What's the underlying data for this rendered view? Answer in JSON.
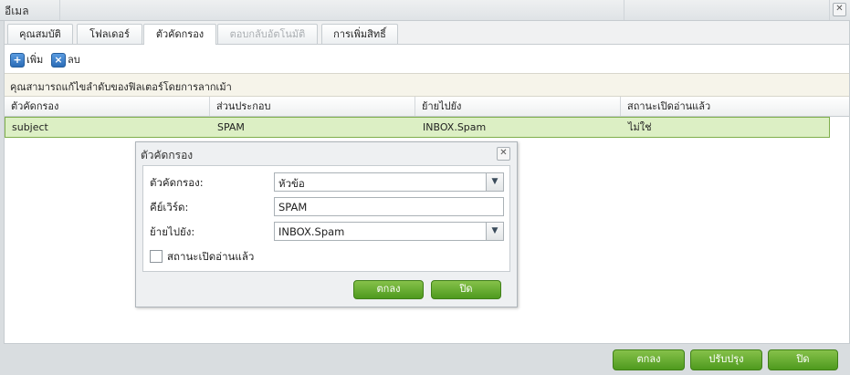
{
  "window": {
    "title": "อีเมล"
  },
  "tabs": [
    {
      "label": "คุณสมบัติ"
    },
    {
      "label": "โฟลเดอร์"
    },
    {
      "label": "ตัวคัดกรอง"
    },
    {
      "label": "ตอบกลับอัตโนมัติ"
    },
    {
      "label": "การเพิ่มสิทธิ์"
    }
  ],
  "toolbar": {
    "add_label": "เพิ่ม",
    "delete_label": "ลบ"
  },
  "info": {
    "text": "คุณสามารถแก้ไขลำดับของฟิลเตอร์โดยการลากเม้า"
  },
  "grid": {
    "headers": [
      "ตัวคัดกรอง",
      "ส่วนประกอบ",
      "ย้ายไปยัง",
      "สถานะเปิดอ่านแล้ว"
    ],
    "rows": [
      {
        "filter": "subject",
        "component": "SPAM",
        "move_to": "INBOX.Spam",
        "read_status": "ไม่ใช่"
      }
    ]
  },
  "dialog": {
    "title": "ตัวคัดกรอง",
    "filter_label": "ตัวคัดกรอง:",
    "filter_value": "หัวข้อ",
    "keyword_label": "คีย์เวิร์ด:",
    "keyword_value": "SPAM",
    "moveto_label": "ย้ายไปยัง:",
    "moveto_value": "INBOX.Spam",
    "mark_read_label": "สถานะเปิดอ่านแล้ว",
    "ok_label": "ตกลง",
    "close_label": "ปิด"
  },
  "footer": {
    "ok_label": "ตกลง",
    "apply_label": "ปรับปรุง",
    "close_label": "ปิด"
  },
  "colors": {
    "accent_green": "#5aa82a",
    "selected_row": "#dcefc4"
  }
}
